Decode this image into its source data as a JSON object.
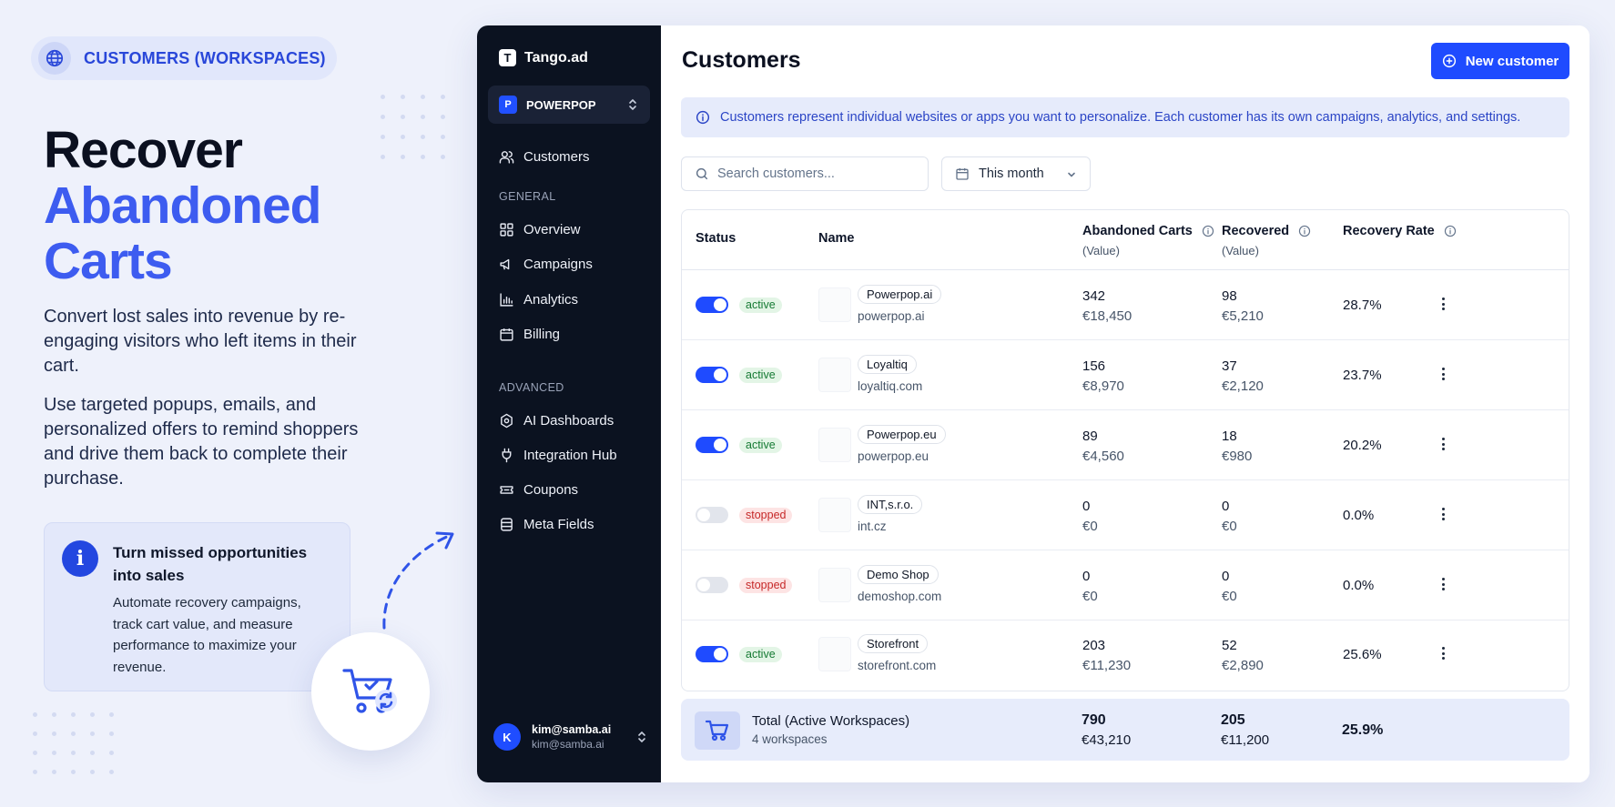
{
  "promo": {
    "badge": "CUSTOMERS (WORKSPACES)",
    "headline_line1": "Recover",
    "headline_line2": "Abandoned",
    "headline_line3": "Carts",
    "para1": "Convert lost sales into revenue by re-engaging visitors who left items in their cart.",
    "para2": "Use targeted popups, emails, and personalized offers to remind shoppers and drive them back to complete their purchase.",
    "card_title": "Turn missed opportunities into sales",
    "card_body": "Automate recovery campaigns, track cart value, and measure performance to maximize your revenue.",
    "icons": [
      "globe-icon",
      "info-icon",
      "cart-refresh-icon"
    ]
  },
  "sidebar": {
    "brand_logo": "T",
    "brand_name": "Tango.ad",
    "workspace_initial": "P",
    "workspace_name": "POWERPOP",
    "top_item": {
      "label": "Customers",
      "icon": "users-icon"
    },
    "section_general": "GENERAL",
    "general_items": [
      {
        "label": "Overview",
        "icon": "grid-icon"
      },
      {
        "label": "Campaigns",
        "icon": "megaphone-icon"
      },
      {
        "label": "Analytics",
        "icon": "bar-chart-icon"
      },
      {
        "label": "Billing",
        "icon": "calendar-icon"
      }
    ],
    "section_advanced": "ADVANCED",
    "advanced_items": [
      {
        "label": "AI Dashboards",
        "icon": "ai-icon"
      },
      {
        "label": "Integration Hub",
        "icon": "plug-icon"
      },
      {
        "label": "Coupons",
        "icon": "ticket-icon"
      },
      {
        "label": "Meta Fields",
        "icon": "database-icon"
      }
    ],
    "user_initial": "K",
    "user_name": "kim@samba.ai",
    "user_email": "kim@samba.ai"
  },
  "main": {
    "title": "Customers",
    "new_button": "New customer",
    "notice": "Customers represent individual websites or apps you want to personalize. Each customer has its own campaigns, analytics, and settings.",
    "search_placeholder": "Search customers...",
    "date_filter": "This month"
  },
  "table": {
    "headers": {
      "status": "Status",
      "name": "Name",
      "abandoned": "Abandoned Carts",
      "abandoned_sub": "(Value)",
      "recovered": "Recovered",
      "recovered_sub": "(Value)",
      "rate": "Recovery Rate"
    },
    "rows": [
      {
        "enabled": true,
        "status": "active",
        "name": "Powerpop.ai",
        "domain": "powerpop.ai",
        "abandoned": "342",
        "abandoned_value": "€18,450",
        "recovered": "98",
        "recovered_value": "€5,210",
        "rate": "28.7%"
      },
      {
        "enabled": true,
        "status": "active",
        "name": "Loyaltiq",
        "domain": "loyaltiq.com",
        "abandoned": "156",
        "abandoned_value": "€8,970",
        "recovered": "37",
        "recovered_value": "€2,120",
        "rate": "23.7%"
      },
      {
        "enabled": true,
        "status": "active",
        "name": "Powerpop.eu",
        "domain": "powerpop.eu",
        "abandoned": "89",
        "abandoned_value": "€4,560",
        "recovered": "18",
        "recovered_value": "€980",
        "rate": "20.2%"
      },
      {
        "enabled": false,
        "status": "stopped",
        "name": "INT,s.r.o.",
        "domain": "int.cz",
        "abandoned": "0",
        "abandoned_value": "€0",
        "recovered": "0",
        "recovered_value": "€0",
        "rate": "0.0%"
      },
      {
        "enabled": false,
        "status": "stopped",
        "name": "Demo Shop",
        "domain": "demoshop.com",
        "abandoned": "0",
        "abandoned_value": "€0",
        "recovered": "0",
        "recovered_value": "€0",
        "rate": "0.0%"
      },
      {
        "enabled": true,
        "status": "active",
        "name": "Storefront",
        "domain": "storefront.com",
        "abandoned": "203",
        "abandoned_value": "€11,230",
        "recovered": "52",
        "recovered_value": "€2,890",
        "rate": "25.6%"
      }
    ]
  },
  "total": {
    "title": "Total (Active Workspaces)",
    "subtitle": "4 workspaces",
    "abandoned": "790",
    "abandoned_value": "€43,210",
    "recovered": "205",
    "recovered_value": "€11,200",
    "rate": "25.9%"
  },
  "colors": {
    "accent": "#1f4bff",
    "headline_accent": "#3d5cf0",
    "sidebar_bg": "#0b1220",
    "active_bg": "#e3f5e6",
    "active_text": "#157a33",
    "stopped_bg": "#fde4e4",
    "stopped_text": "#c62828"
  }
}
